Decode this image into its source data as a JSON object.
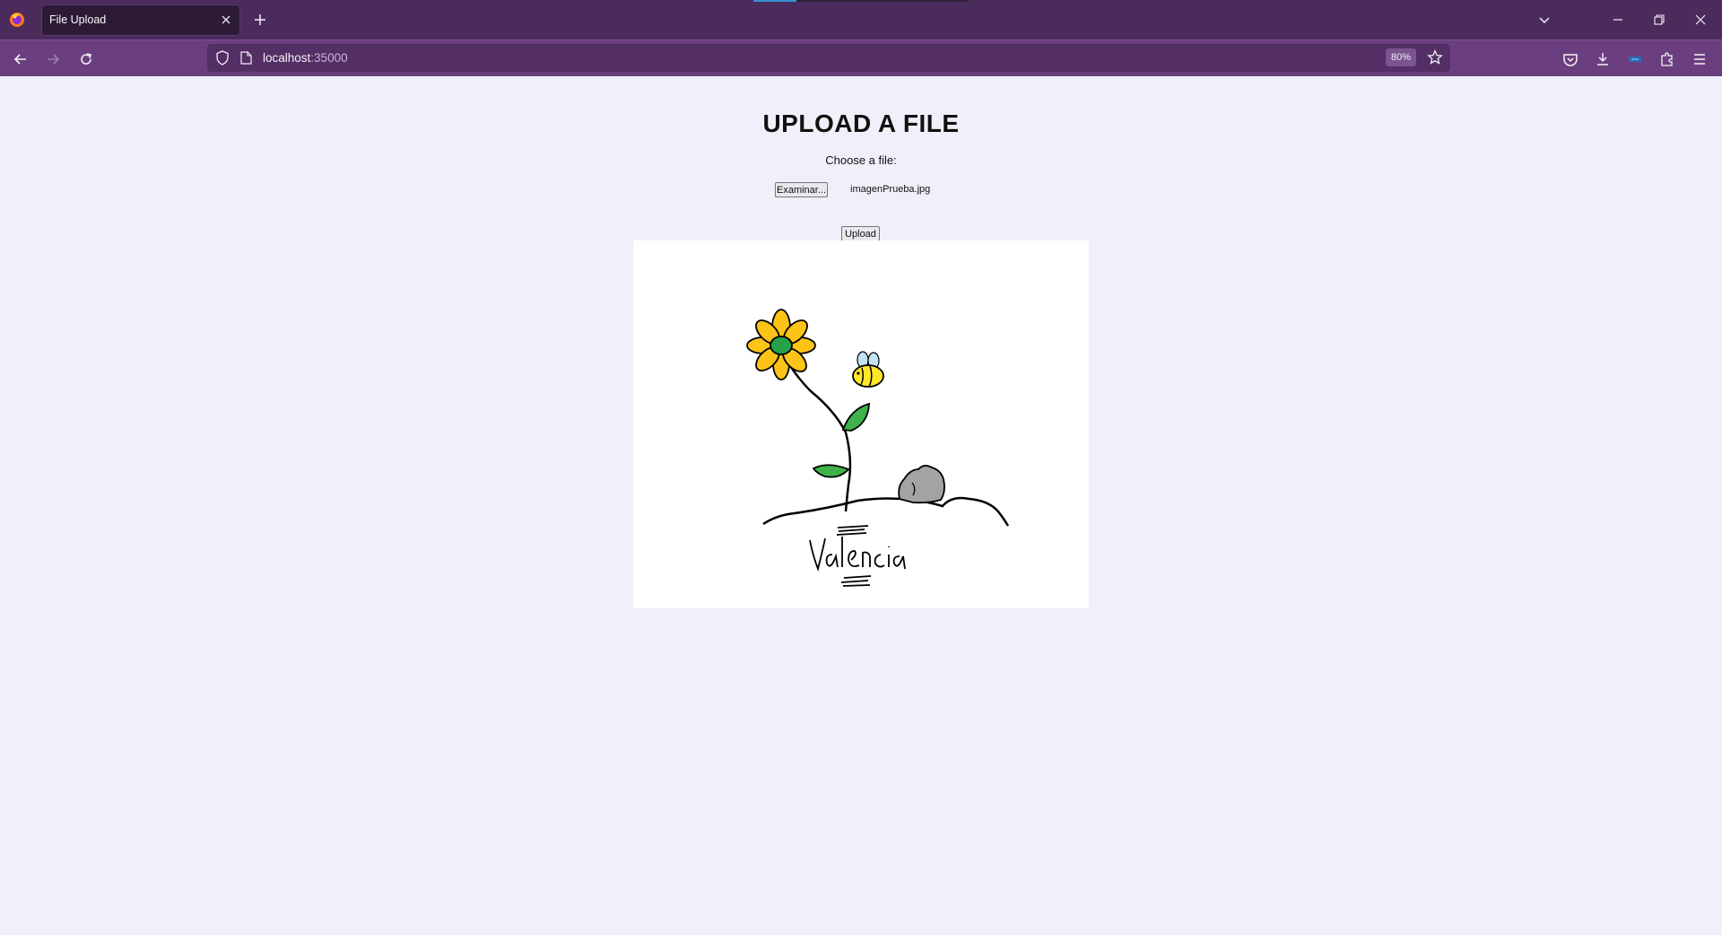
{
  "browser": {
    "tab_title": "File Upload",
    "url_host": "localhost",
    "url_port": ":35000",
    "zoom": "80%"
  },
  "page": {
    "heading": "UPLOAD A FILE",
    "choose_label": "Choose a file:",
    "browse_button": "Examinar...",
    "selected_file": "imagenPrueba.jpg",
    "upload_button": "Upload"
  },
  "preview": {
    "signature": "Valencia"
  },
  "icons": [
    "firefox-icon",
    "close-icon",
    "plus-icon",
    "chevron-down-icon",
    "minimize-icon",
    "restore-icon",
    "close-window-icon",
    "back-icon",
    "forward-icon",
    "reload-icon",
    "shield-icon",
    "page-icon",
    "star-icon",
    "pocket-icon",
    "download-icon",
    "extension-icon",
    "puzzle-icon",
    "menu-icon"
  ],
  "colors": {
    "tabbar": "#4b2a5c",
    "navbar": "#6b3f7f",
    "page_bg": "#f0f0fb"
  }
}
